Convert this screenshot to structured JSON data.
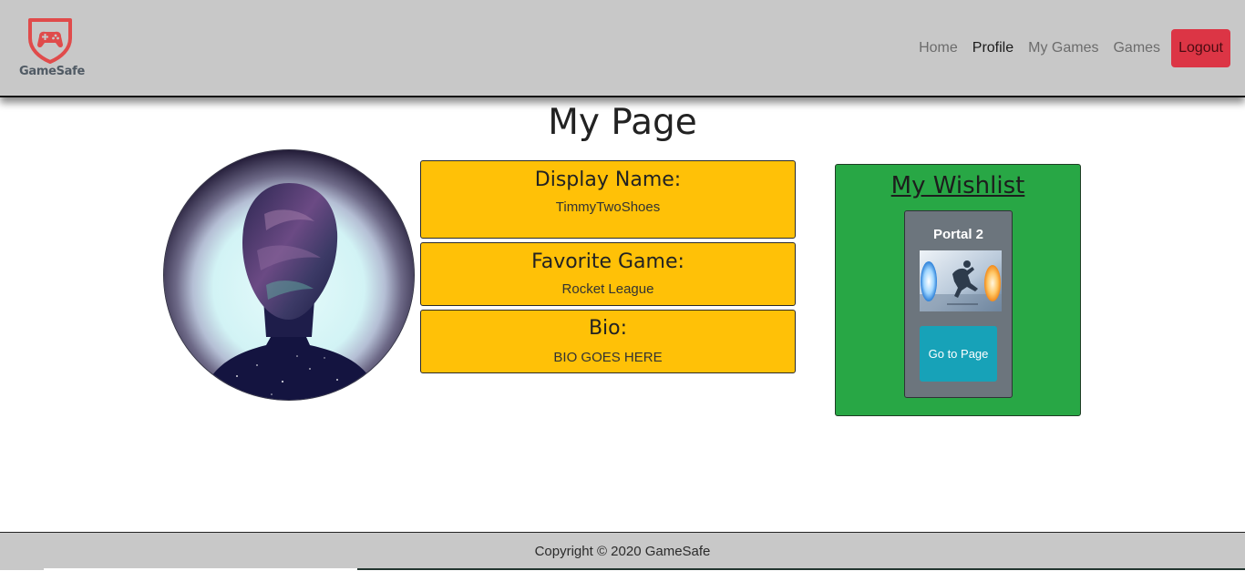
{
  "brand": {
    "name": "GameSafe",
    "logo_icon": "gamepad-shield-icon",
    "logo_color": "#e04b4b"
  },
  "nav": {
    "items": [
      {
        "label": "Home",
        "active": false
      },
      {
        "label": "Profile",
        "active": true
      },
      {
        "label": "My Games",
        "active": false
      },
      {
        "label": "Games",
        "active": false
      }
    ],
    "logout_label": "Logout"
  },
  "page": {
    "title": "My Page"
  },
  "profile": {
    "avatar_icon": "silhouette-avatar-image",
    "display_name_label": "Display Name:",
    "display_name": "TimmyTwoShoes",
    "favorite_game_label": "Favorite Game:",
    "favorite_game": "Rocket League",
    "bio_label": "Bio:",
    "bio": "BIO GOES HERE"
  },
  "wishlist": {
    "title": "My Wishlist",
    "items": [
      {
        "name": "Portal 2",
        "cover_icon": "portal-2-cover-image",
        "button_label": "Go to Page"
      }
    ]
  },
  "footer": {
    "text": "Copyright © 2020 GameSafe"
  },
  "colors": {
    "header_bg": "#c8c8c8",
    "card_yellow": "#ffc107",
    "wishlist_green": "#28a745",
    "game_card_gray": "#6c757d",
    "button_teal": "#17a2b8",
    "logout_red": "#dc3545"
  }
}
